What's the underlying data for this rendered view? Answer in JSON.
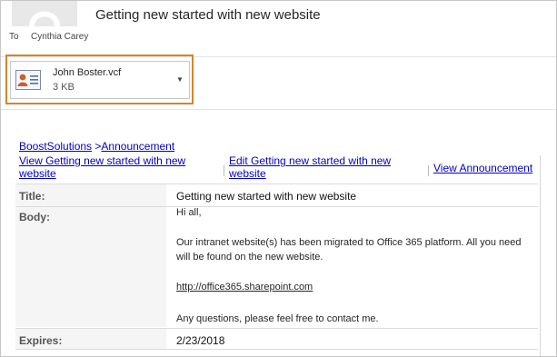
{
  "message": {
    "subject": "Getting new started with new website",
    "to_label": "To",
    "to_name": "Cynthia Carey"
  },
  "attachment": {
    "name": "John Boster.vcf",
    "size": "3 KB",
    "icon": "vcard-icon"
  },
  "breadcrumb": {
    "site": "BoostSolutions",
    "separator": ">",
    "list": "Announcement"
  },
  "actions": {
    "view_item": "View Getting new started with new website",
    "edit_item": "Edit Getting new started with new website",
    "view_list": "View Announcement"
  },
  "fields": {
    "title_label": "Title:",
    "title_value": "Getting new started with new website",
    "body_label": "Body:",
    "body": {
      "greeting": "Hi all,",
      "paragraph": "Our intranet website(s) has been migrated to Office 365 platform. All you need will be found on the new website.",
      "link": "http://office365.sharepoint.com",
      "closing": "Any questions, please feel free to contact me."
    },
    "expires_label": "Expires:",
    "expires_value": "2/23/2018"
  },
  "colors": {
    "highlight": "#d9822b",
    "link": "#0000cc"
  }
}
